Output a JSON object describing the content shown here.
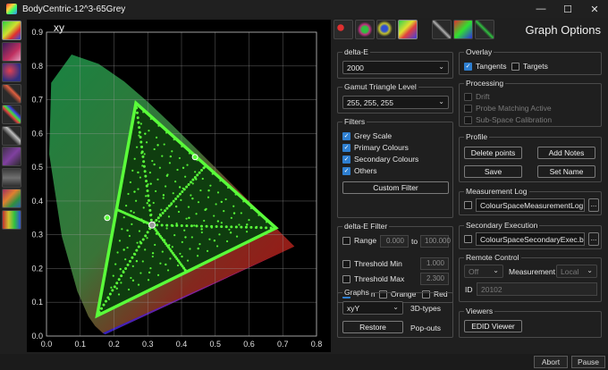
{
  "window": {
    "title": "BodyCentric-12^3-65Grey",
    "controls": [
      "—",
      "☐",
      "✕"
    ]
  },
  "left_tools": [
    "chromaticity-icon",
    "saturation-icon",
    "colour-scatter-icon",
    "gradient-ramp-icon",
    "spectrum-ramp-icon",
    "grey-ramp-icon",
    "cube-icon",
    "luminance-icon",
    "swatch-grid-icon",
    "waveform-icon"
  ],
  "top_icons": [
    "primaries-icon",
    "dots-icon",
    "measure-icon",
    "gamut-icon",
    "ramp-cross-icon",
    "hue-cross-icon",
    "grid-cross-icon"
  ],
  "panel_title": "Graph Options",
  "plot": {
    "x_label": "xy",
    "x_ticks": [
      "0.0",
      "0.1",
      "0.2",
      "0.3",
      "0.4",
      "0.5",
      "0.6",
      "0.7",
      "0.8"
    ],
    "y_ticks": [
      "0.9",
      "0.8",
      "0.7",
      "0.6",
      "0.5",
      "0.4",
      "0.3",
      "0.2",
      "0.1",
      "0.0"
    ],
    "target_triangle": {
      "red": [
        0.68,
        0.32
      ],
      "green": [
        0.265,
        0.69
      ],
      "blue": [
        0.15,
        0.06
      ]
    },
    "white_point": [
      0.3127,
      0.329
    ],
    "markers": [
      [
        0.18,
        0.35
      ],
      [
        0.44,
        0.53
      ]
    ]
  },
  "delta_e": {
    "title": "delta-E",
    "value": "2000"
  },
  "gamut_level": {
    "title": "Gamut Triangle Level",
    "value": "255, 255, 255"
  },
  "filters": {
    "title": "Filters",
    "items": [
      {
        "label": "Grey Scale",
        "checked": true
      },
      {
        "label": "Primary Colours",
        "checked": true
      },
      {
        "label": "Secondary Colours",
        "checked": true
      },
      {
        "label": "Others",
        "checked": true
      }
    ],
    "custom_button": "Custom Filter"
  },
  "delta_e_filter": {
    "title": "delta-E Filter",
    "range_label": "Range",
    "range_min": "0.000",
    "to_label": "to",
    "range_max": "100.000",
    "threshold_min_label": "Threshold Min",
    "threshold_min": "1.000",
    "threshold_max_label": "Threshold Max",
    "threshold_max": "2.300",
    "green_label": "Green",
    "orange_label": "Orange",
    "red_label": "Red"
  },
  "graphs": {
    "title": "Graphs",
    "value": "xyY",
    "types_label": "3D-types",
    "restore_button": "Restore",
    "popouts_label": "Pop-outs"
  },
  "overlay": {
    "title": "Overlay",
    "tangents": "Tangents",
    "targets": "Targets"
  },
  "processing": {
    "title": "Processing",
    "items": [
      "Drift",
      "Probe Matching Active",
      "Sub-Space Calibration"
    ]
  },
  "profile": {
    "title": "Profile",
    "buttons": [
      "Delete points",
      "Add Notes",
      "Save",
      "Set Name"
    ]
  },
  "measurement_log": {
    "title": "Measurement Log",
    "value": "ColourSpaceMeasurementLog.csv",
    "browse": "..."
  },
  "secondary_exec": {
    "title": "Secondary Execution",
    "value": "ColourSpaceSecondaryExec.bat",
    "browse": "..."
  },
  "remote": {
    "title": "Remote Control",
    "mode": "Off",
    "measurement_label": "Measurement",
    "measurement_value": "Local",
    "id_label": "ID",
    "id_value": "20102"
  },
  "viewers": {
    "title": "Viewers",
    "button": "EDID Viewer"
  },
  "status": {
    "abort": "Abort",
    "pause": "Pause"
  },
  "colors": {
    "accent": "#2e7fd1",
    "point_green": "#5aff3a",
    "background": "#1f1f1f"
  }
}
